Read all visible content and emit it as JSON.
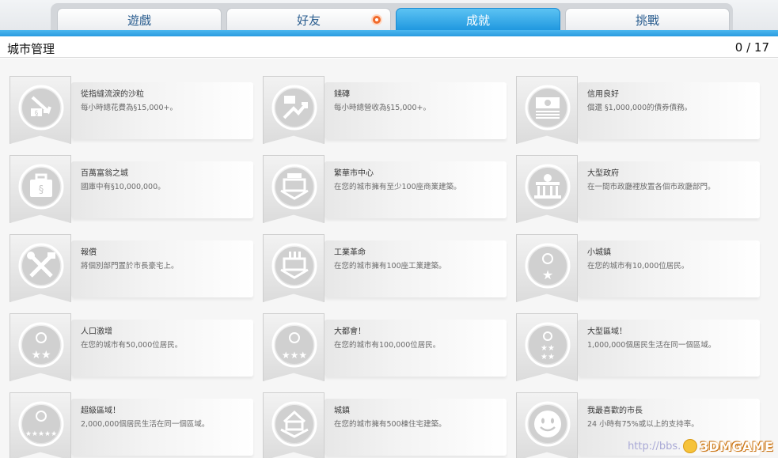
{
  "tabs": [
    {
      "label": "遊戲",
      "active": false,
      "badge": false
    },
    {
      "label": "好友",
      "active": false,
      "badge": true
    },
    {
      "label": "成就",
      "active": true,
      "badge": false
    },
    {
      "label": "挑戰",
      "active": false,
      "badge": false
    }
  ],
  "header": {
    "title": "城市管理",
    "count": "0 / 17"
  },
  "achievements": [
    {
      "name": "從指縫流淚的沙粒",
      "desc": "每小時總花費為§15,000+。",
      "icon": "money-down-icon"
    },
    {
      "name": "錢磚",
      "desc": "每小時總營收為§15,000+。",
      "icon": "money-up-icon"
    },
    {
      "name": "信用良好",
      "desc": "償還 §1,000,000的債券債務。",
      "icon": "bond-icon"
    },
    {
      "name": "百萬富翁之城",
      "desc": "國庫中有§10,000,000。",
      "icon": "money-bag-icon"
    },
    {
      "name": "繁華市中心",
      "desc": "在您的城市擁有至少100座商業建築。",
      "icon": "shop-icon"
    },
    {
      "name": "大型政府",
      "desc": "在一間市政廳裡放置各個市政廳部門。",
      "icon": "city-hall-icon"
    },
    {
      "name": "報償",
      "desc": "將個別部門置於市長豪宅上。",
      "icon": "tools-icon"
    },
    {
      "name": "工業革命",
      "desc": "在您的城市擁有100座工業建築。",
      "icon": "factory-icon"
    },
    {
      "name": "小城鎮",
      "desc": "在您的城市有10,000位居民。",
      "icon": "one-star-icon"
    },
    {
      "name": "人口激增",
      "desc": "在您的城市有50,000位居民。",
      "icon": "two-star-icon"
    },
    {
      "name": "大都會！",
      "desc": "在您的城市有100,000位居民。",
      "icon": "three-star-icon"
    },
    {
      "name": "大型區域！",
      "desc": "1,000,000個居民生活在同一個區域。",
      "icon": "four-star-icon"
    },
    {
      "name": "超級區域！",
      "desc": "2,000,000個居民生活在同一個區域。",
      "icon": "five-star-icon"
    },
    {
      "name": "城鎮",
      "desc": "在您的城市擁有500棟住宅建築。",
      "icon": "house-icon"
    },
    {
      "name": "我最喜歡的市長",
      "desc": "24 小時有75%或以上的支持率。",
      "icon": "smiley-icon"
    }
  ],
  "watermark": {
    "url": "http://bbs.",
    "logo": "3DMGAME"
  },
  "colors": {
    "accent": "#2a9be0",
    "tab_text": "#2a5d8f",
    "badge": "#f06a2b"
  }
}
